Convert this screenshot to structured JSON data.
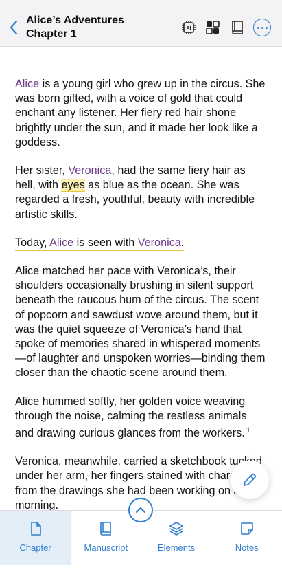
{
  "header": {
    "book_title": "Alice’s Adventures",
    "chapter_title": "Chapter 1",
    "icons": [
      "back-chevron-icon",
      "ai-chip-icon",
      "layout-icon",
      "book-icon",
      "more-icon"
    ],
    "accent": "#2f7fd0"
  },
  "content": {
    "p1": {
      "name": "Alice",
      "rest": " is a young girl who grew up in the circus. She was born gifted, with a voice of gold that could enchant any listener. Her fiery red hair shone brightly under the sun, and it made her look like a goddess."
    },
    "p2": {
      "pre": "Her sister, ",
      "name": "Veronica",
      "mid": ", had the same fiery hair as hell, with ",
      "highlight": "eyes",
      "post": " as blue as the ocean. She was regarded a fresh, youthful, beauty with incredible artistic skills."
    },
    "p3": {
      "pre": "Today, ",
      "name1": "Alice",
      "mid": " is seen with ",
      "name2": "Veronica",
      "post": "."
    },
    "p4": "Alice matched her pace with Veronica’s, their shoulders occasionally brushing in silent support beneath the raucous hum of the circus. The scent of popcorn and sawdust wove around them, but it was the quiet squeeze of Veronica’s hand that spoke of memories shared in whispered moments—of laughter and unspoken worries—binding them closer than the chaotic scene around them.",
    "p5": {
      "text": "Alice hummed softly, her golden voice weaving through the noise, calming the restless animals and drawing curious glances from the workers.",
      "footnote": "1"
    },
    "p6": "Veronica, meanwhile, carried a sketchbook tucked under her arm, her fingers stained with charcoal from the drawings she had been working on all morning.",
    "name_color": "#6e3b8a",
    "highlight_color": "#e9c640"
  },
  "fab": {
    "icon": "pencil-icon"
  },
  "scroll_up": {
    "icon": "chevron-up-icon"
  },
  "bottom_nav": {
    "items": [
      {
        "label": "Chapter",
        "icon": "page-icon",
        "active": true
      },
      {
        "label": "Manuscript",
        "icon": "book-icon",
        "active": false
      },
      {
        "label": "Elements",
        "icon": "layers-icon",
        "active": false
      },
      {
        "label": "Notes",
        "icon": "note-icon",
        "active": false
      }
    ]
  }
}
